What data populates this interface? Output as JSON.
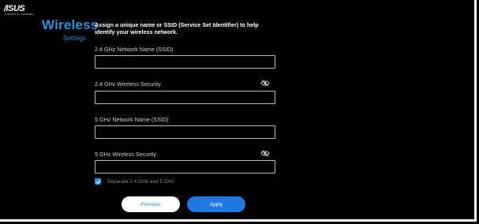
{
  "brand": {
    "logo_text": "/ISUS",
    "tagline": "IN SEARCH OF INCREDIBLE"
  },
  "sidebar": {
    "title": "Wireless",
    "subtitle": "Settings"
  },
  "main": {
    "intro": "Assign a unique name or SSID (Service Set Identifier) to help identify your wireless network.",
    "fields": [
      {
        "label": "2.4 GHz Network Name (SSID)",
        "value": ""
      },
      {
        "label": "2.4 GHz Wireless Security",
        "value": ""
      },
      {
        "label": "5 GHz Network Name (SSID)",
        "value": ""
      },
      {
        "label": "5 GHz Wireless Security",
        "value": ""
      }
    ],
    "separate_checkbox": {
      "label": "Separate 2.4 GHz and 5 GHz",
      "checked": true
    }
  },
  "buttons": {
    "previous": "Previous",
    "apply": "Apply"
  },
  "colors": {
    "background": "#000000",
    "accent": "#2c8fd9",
    "apply_button": "#1f78e0"
  },
  "icons": {
    "password_toggle": "eye-off-icon",
    "checkbox": "checkmark-icon"
  }
}
